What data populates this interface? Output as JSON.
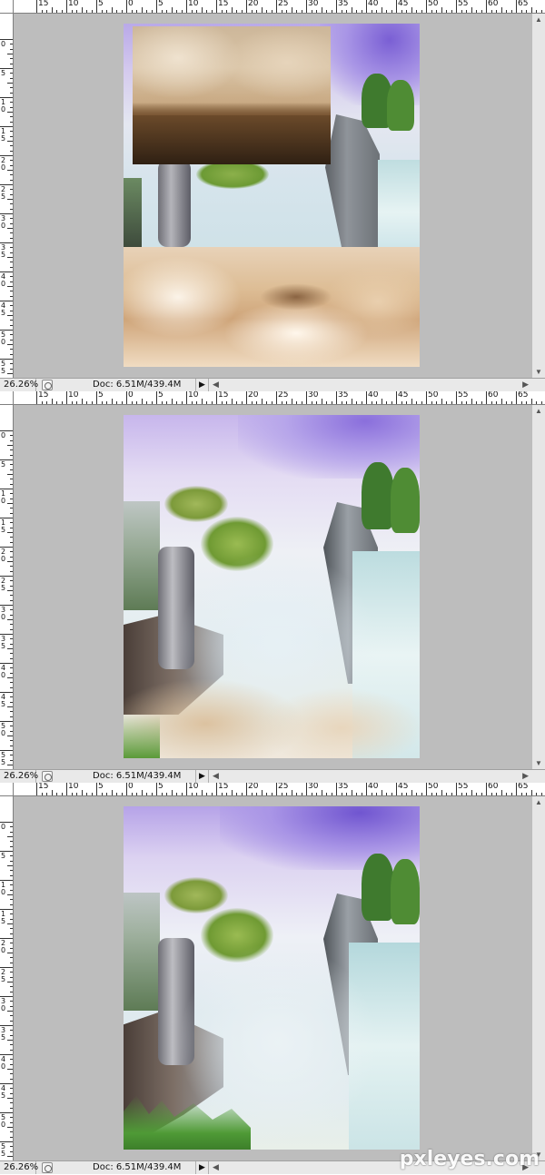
{
  "ruler": {
    "top_labels": [
      "15",
      "10",
      "5",
      "0",
      "5",
      "10",
      "15",
      "20",
      "25",
      "30",
      "35",
      "40",
      "45",
      "50",
      "55",
      "60",
      "65"
    ],
    "side_labels": [
      "0",
      "5",
      "1 0",
      "1 5",
      "2 0",
      "2 5",
      "3 0",
      "3 5",
      "4 0",
      "4 5",
      "5 0",
      "5 5"
    ]
  },
  "status": {
    "zoom": "26.26%",
    "doc": "Doc: 6.51M/439.4M",
    "play_icon": "play-arrow"
  },
  "watermark": "pxleyes.com",
  "colors": {
    "ruler_bg": "#ffffff",
    "workspace_bg": "#bdbdbd",
    "status_bg": "#e9e9e9"
  }
}
